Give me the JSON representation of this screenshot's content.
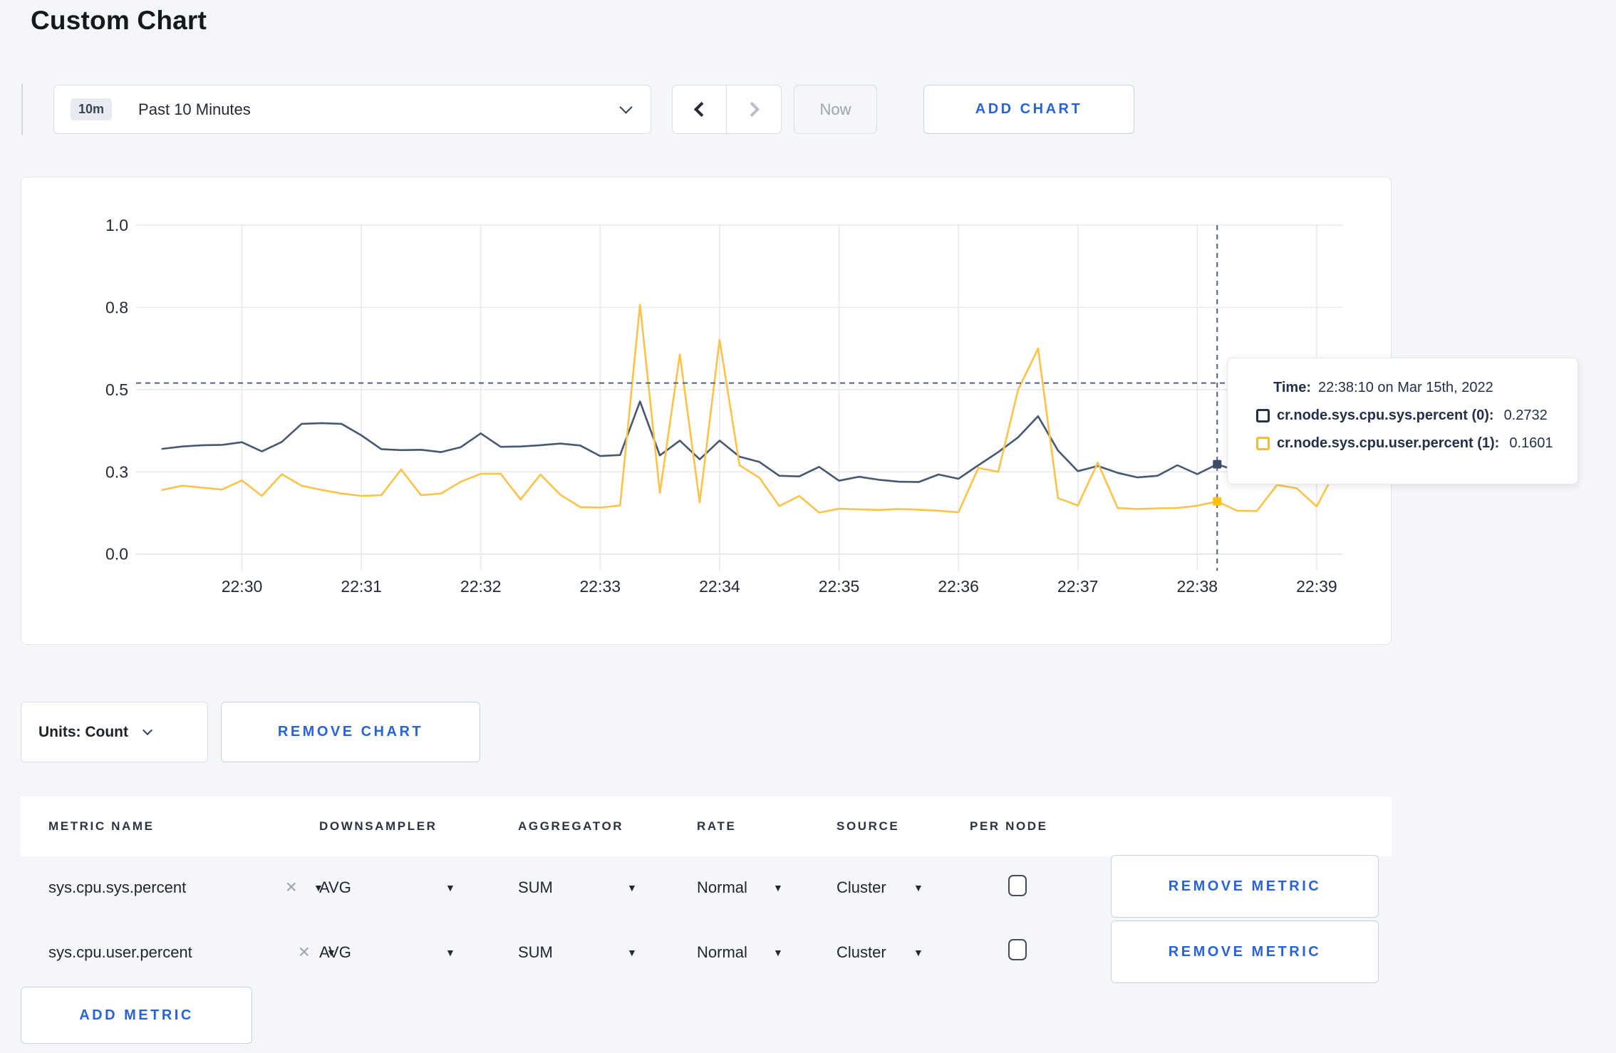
{
  "page": {
    "title": "Custom Chart"
  },
  "toolbar": {
    "time_range": {
      "badge": "10m",
      "label": "Past 10 Minutes"
    },
    "now_label": "Now",
    "add_chart_label": "ADD CHART"
  },
  "chart_data": {
    "type": "line",
    "title": "",
    "xlabel": "",
    "ylabel": "",
    "ylim": [
      0,
      1
    ],
    "grid": true,
    "y_tick_labels": [
      "0.0",
      "0.3",
      "0.5",
      "0.8",
      "1.0"
    ],
    "y_tick_fractions": [
      0,
      0.25,
      0.5,
      0.75,
      1
    ],
    "x_tick_labels": [
      "22:30",
      "22:31",
      "22:32",
      "22:33",
      "22:34",
      "22:35",
      "22:36",
      "22:37",
      "22:38",
      "22:39"
    ],
    "x_start": "22:29:20",
    "x_end": "22:39:10",
    "point_interval_sec": 10,
    "series": [
      {
        "name": "cr.node.sys.cpu.sys.percent (0)",
        "color": "#475872",
        "values": [
          0.32,
          0.327,
          0.331,
          0.332,
          0.34,
          0.312,
          0.341,
          0.396,
          0.398,
          0.396,
          0.361,
          0.319,
          0.316,
          0.317,
          0.31,
          0.325,
          0.367,
          0.326,
          0.327,
          0.331,
          0.336,
          0.33,
          0.298,
          0.301,
          0.464,
          0.3,
          0.345,
          0.288,
          0.345,
          0.296,
          0.28,
          0.238,
          0.236,
          0.265,
          0.223,
          0.235,
          0.226,
          0.22,
          0.219,
          0.242,
          0.229,
          0.27,
          0.31,
          0.355,
          0.419,
          0.315,
          0.252,
          0.268,
          0.247,
          0.233,
          0.238,
          0.27,
          0.243,
          0.2732,
          0.253,
          0.295,
          0.3,
          0.31,
          0.295,
          0.305
        ]
      },
      {
        "name": "cr.node.sys.cpu.user.percent (1)",
        "color": "#FBC34A",
        "values": [
          0.195,
          0.208,
          0.202,
          0.196,
          0.224,
          0.177,
          0.243,
          0.208,
          0.195,
          0.184,
          0.177,
          0.179,
          0.257,
          0.179,
          0.184,
          0.22,
          0.244,
          0.244,
          0.166,
          0.242,
          0.18,
          0.143,
          0.141,
          0.148,
          0.758,
          0.186,
          0.607,
          0.157,
          0.651,
          0.27,
          0.232,
          0.146,
          0.177,
          0.126,
          0.138,
          0.136,
          0.134,
          0.137,
          0.135,
          0.132,
          0.127,
          0.262,
          0.25,
          0.5,
          0.625,
          0.17,
          0.148,
          0.278,
          0.14,
          0.137,
          0.139,
          0.14,
          0.147,
          0.1601,
          0.132,
          0.131,
          0.21,
          0.2,
          0.145,
          0.26
        ]
      }
    ],
    "hover": {
      "index": 53,
      "crosshair_value": 0.52,
      "time_prefix": "Time:",
      "time_label": "22:38:10 on Mar 15th, 2022",
      "rows": [
        {
          "label": "cr.node.sys.cpu.sys.percent (0):",
          "value": "0.2732",
          "color": "#223049"
        },
        {
          "label": "cr.node.sys.cpu.user.percent (1):",
          "value": "0.1601",
          "color": "#FFC200"
        }
      ]
    }
  },
  "units_bar": {
    "units_label": "Units: Count",
    "remove_chart_label": "REMOVE CHART"
  },
  "metrics_table": {
    "columns": [
      "METRIC NAME",
      "DOWNSAMPLER",
      "AGGREGATOR",
      "RATE",
      "SOURCE",
      "PER NODE"
    ],
    "rows": [
      {
        "metric": "sys.cpu.sys.percent",
        "downsampler": "AVG",
        "aggregator": "SUM",
        "rate": "Normal",
        "source": "Cluster",
        "per_node_checked": false,
        "remove_label": "REMOVE METRIC"
      },
      {
        "metric": "sys.cpu.user.percent",
        "downsampler": "AVG",
        "aggregator": "SUM",
        "rate": "Normal",
        "source": "Cluster",
        "per_node_checked": false,
        "remove_label": "REMOVE METRIC"
      }
    ],
    "add_metric_label": "ADD METRIC",
    "remove_icon": "✕",
    "caret_icon": "▼"
  }
}
